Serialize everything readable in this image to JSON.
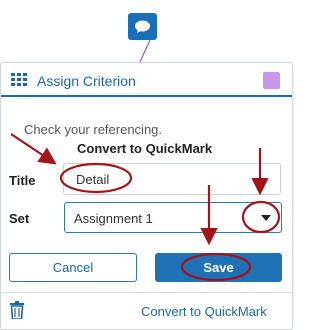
{
  "header": {
    "title": "Assign Criterion",
    "swatch_color": "#c996ea"
  },
  "background_text": "Check your referencing.",
  "dialog": {
    "title": "Convert to QuickMark",
    "fields": {
      "title_label": "Title",
      "title_value": "Detail",
      "set_label": "Set",
      "set_value": "Assignment 1"
    },
    "buttons": {
      "cancel": "Cancel",
      "save": "Save"
    }
  },
  "footer": {
    "link": "Convert to QuickMark"
  },
  "colors": {
    "accent": "#1b67a8",
    "annotation": "#a3141a"
  },
  "icons": [
    "comment-icon",
    "grid-icon",
    "trash-icon",
    "chevron-down-icon"
  ]
}
